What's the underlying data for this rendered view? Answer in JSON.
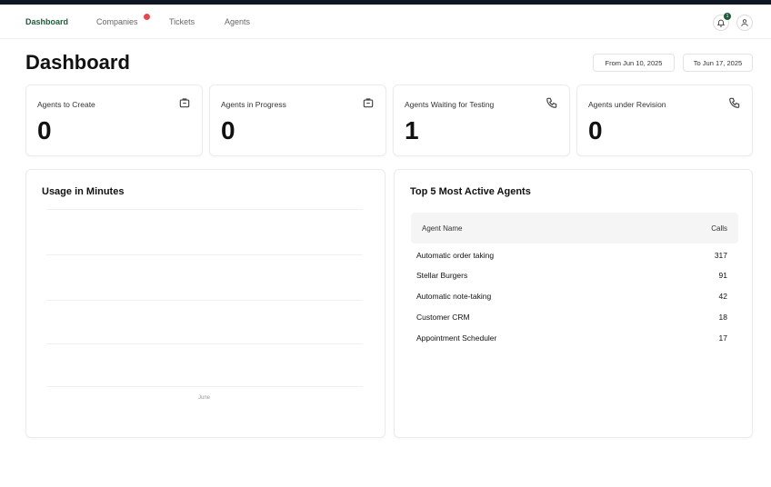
{
  "nav": {
    "items": [
      {
        "label": "Dashboard",
        "active": true
      },
      {
        "label": "Companies",
        "active": false,
        "has_badge": true
      },
      {
        "label": "Tickets",
        "active": false
      },
      {
        "label": "Agents",
        "active": false
      }
    ],
    "notification_count": "1",
    "icons": [
      "bell-icon",
      "user-icon"
    ]
  },
  "page": {
    "title": "Dashboard",
    "date_from": "From Jun 10, 2025",
    "date_to": "To Jun 17, 2025"
  },
  "stats": [
    {
      "label": "Agents to Create",
      "value": "0",
      "icon": "briefcase-icon"
    },
    {
      "label": "Agents in Progress",
      "value": "0",
      "icon": "briefcase-icon"
    },
    {
      "label": "Agents Waiting for Testing",
      "value": "1",
      "icon": "phone-icon"
    },
    {
      "label": "Agents under Revision",
      "value": "0",
      "icon": "phone-icon"
    }
  ],
  "usage": {
    "title": "Usage in Minutes",
    "x_ticks": [
      "June"
    ]
  },
  "top_agents": {
    "title": "Top 5 Most Active Agents",
    "columns": [
      "Agent Name",
      "Calls"
    ],
    "rows": [
      {
        "name": "Automatic order taking",
        "calls": "317"
      },
      {
        "name": "Stellar Burgers",
        "calls": "91"
      },
      {
        "name": "Automatic note-taking",
        "calls": "42"
      },
      {
        "name": "Customer CRM",
        "calls": "18"
      },
      {
        "name": "Appointment Scheduler",
        "calls": "17"
      }
    ]
  },
  "colors": {
    "accent": "#1d5b3a",
    "badge": "#e5484d",
    "topbar": "#0f1725"
  }
}
